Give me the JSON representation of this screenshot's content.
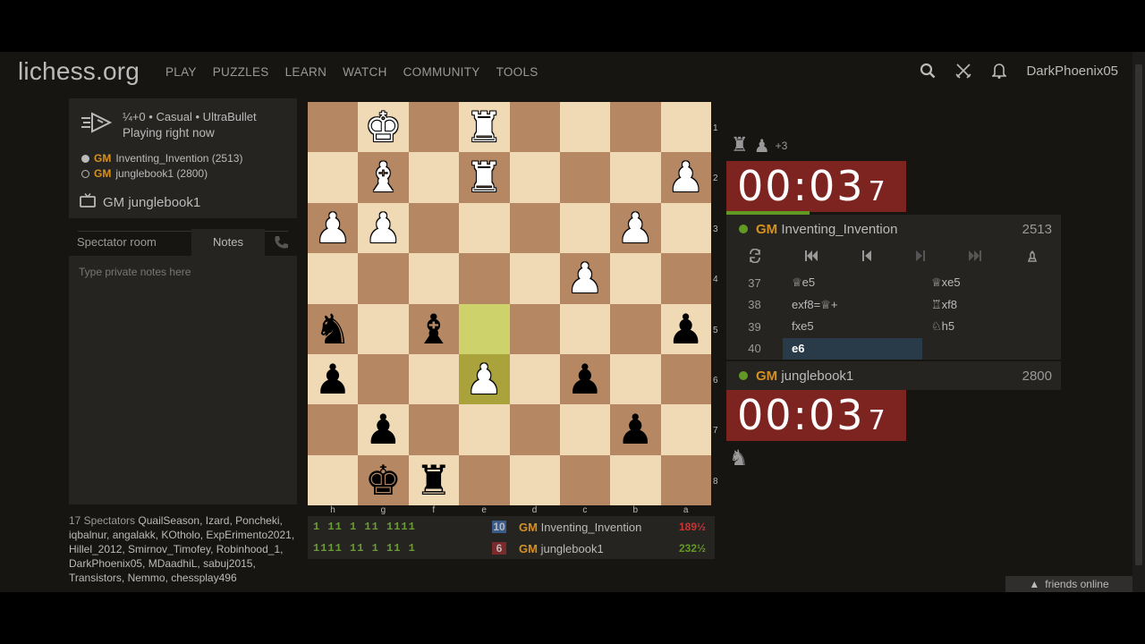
{
  "header": {
    "logo": "lichess.org",
    "nav": [
      "PLAY",
      "PUZZLES",
      "LEARN",
      "WATCH",
      "COMMUNITY",
      "TOOLS"
    ],
    "username": "DarkPhoenix05",
    "icons": [
      "search-icon",
      "swords-icon",
      "bell-icon"
    ]
  },
  "game_info": {
    "line1": "¼+0 • Casual • UltraBullet",
    "line2": "Playing right now",
    "white_title": "GM",
    "white_player": "Inventing_Invention (2513)",
    "black_title": "GM",
    "black_player": "junglebook1 (2800)",
    "tv_label": "GM junglebook1"
  },
  "tabs": {
    "spectator": "Spectator room",
    "notes": "Notes"
  },
  "notes": {
    "placeholder": "Type private notes here"
  },
  "spectators": {
    "count": "17 Spectators",
    "names": "QuailSeason, Izard, Poncheki, iqbalnur, angalakk, KOtholo, ExpErimento2021, Hillel_2012, Smirnov_Timofey, Robinhood_1, DarkPhoenix05, MDaadhiL, sabuj2015, Transistors, Nemmo, chessplay496"
  },
  "board": {
    "orientation": "black",
    "ranks": [
      "1",
      "2",
      "3",
      "4",
      "5",
      "6",
      "7",
      "8"
    ],
    "files": [
      "h",
      "g",
      "f",
      "e",
      "d",
      "c",
      "b",
      "a"
    ],
    "highlight_squares": [
      "e5",
      "e6"
    ],
    "pieces": [
      {
        "sq": "g1",
        "glyph": "♚",
        "color": "w"
      },
      {
        "sq": "e1",
        "glyph": "♜",
        "color": "w"
      },
      {
        "sq": "g2",
        "glyph": "♝",
        "color": "w"
      },
      {
        "sq": "e2",
        "glyph": "♜",
        "color": "w"
      },
      {
        "sq": "a2",
        "glyph": "♟",
        "color": "w"
      },
      {
        "sq": "h3",
        "glyph": "♟",
        "color": "w"
      },
      {
        "sq": "g3",
        "glyph": "♟",
        "color": "w"
      },
      {
        "sq": "b3",
        "glyph": "♟",
        "color": "w"
      },
      {
        "sq": "c4",
        "glyph": "♟",
        "color": "w"
      },
      {
        "sq": "h5",
        "glyph": "♞",
        "color": "b"
      },
      {
        "sq": "f5",
        "glyph": "♝",
        "color": "b"
      },
      {
        "sq": "a5",
        "glyph": "♟",
        "color": "b"
      },
      {
        "sq": "h6",
        "glyph": "♟",
        "color": "b"
      },
      {
        "sq": "e6",
        "glyph": "♟",
        "color": "w"
      },
      {
        "sq": "c6",
        "glyph": "♟",
        "color": "b"
      },
      {
        "sq": "g7",
        "glyph": "♟",
        "color": "b"
      },
      {
        "sq": "b7",
        "glyph": "♟",
        "color": "b"
      },
      {
        "sq": "g8",
        "glyph": "♚",
        "color": "b"
      },
      {
        "sq": "f8",
        "glyph": "♜",
        "color": "b"
      }
    ]
  },
  "score_table": {
    "rows": [
      {
        "digits": "1  11  1  11  1111",
        "num": "10",
        "title": "GM",
        "name": "Inventing_Invention",
        "perf": "189½",
        "perf_color": "#cc3333"
      },
      {
        "digits": "1111  11  1  11  1",
        "num": "6",
        "title": "GM",
        "name": "junglebook1",
        "perf": "232½",
        "perf_color": "#629924"
      }
    ]
  },
  "right": {
    "material": "+3",
    "top_clock": {
      "main": "00:03",
      "tenth": "7"
    },
    "bottom_clock": {
      "main": "00:03",
      "tenth": "7"
    },
    "top_player": {
      "title": "GM",
      "name": "Inventing_Invention",
      "rating": "2513"
    },
    "bottom_player": {
      "title": "GM",
      "name": "junglebook1",
      "rating": "2800"
    },
    "moves": [
      {
        "n": "37",
        "w": "♕e5",
        "b": "♕xe5"
      },
      {
        "n": "38",
        "w": "exf8=♕+",
        "b": "♖xf8"
      },
      {
        "n": "39",
        "w": "fxe5",
        "b": "♘h5"
      },
      {
        "n": "40",
        "w": "e6",
        "b": ""
      }
    ],
    "friends": "friends online"
  }
}
